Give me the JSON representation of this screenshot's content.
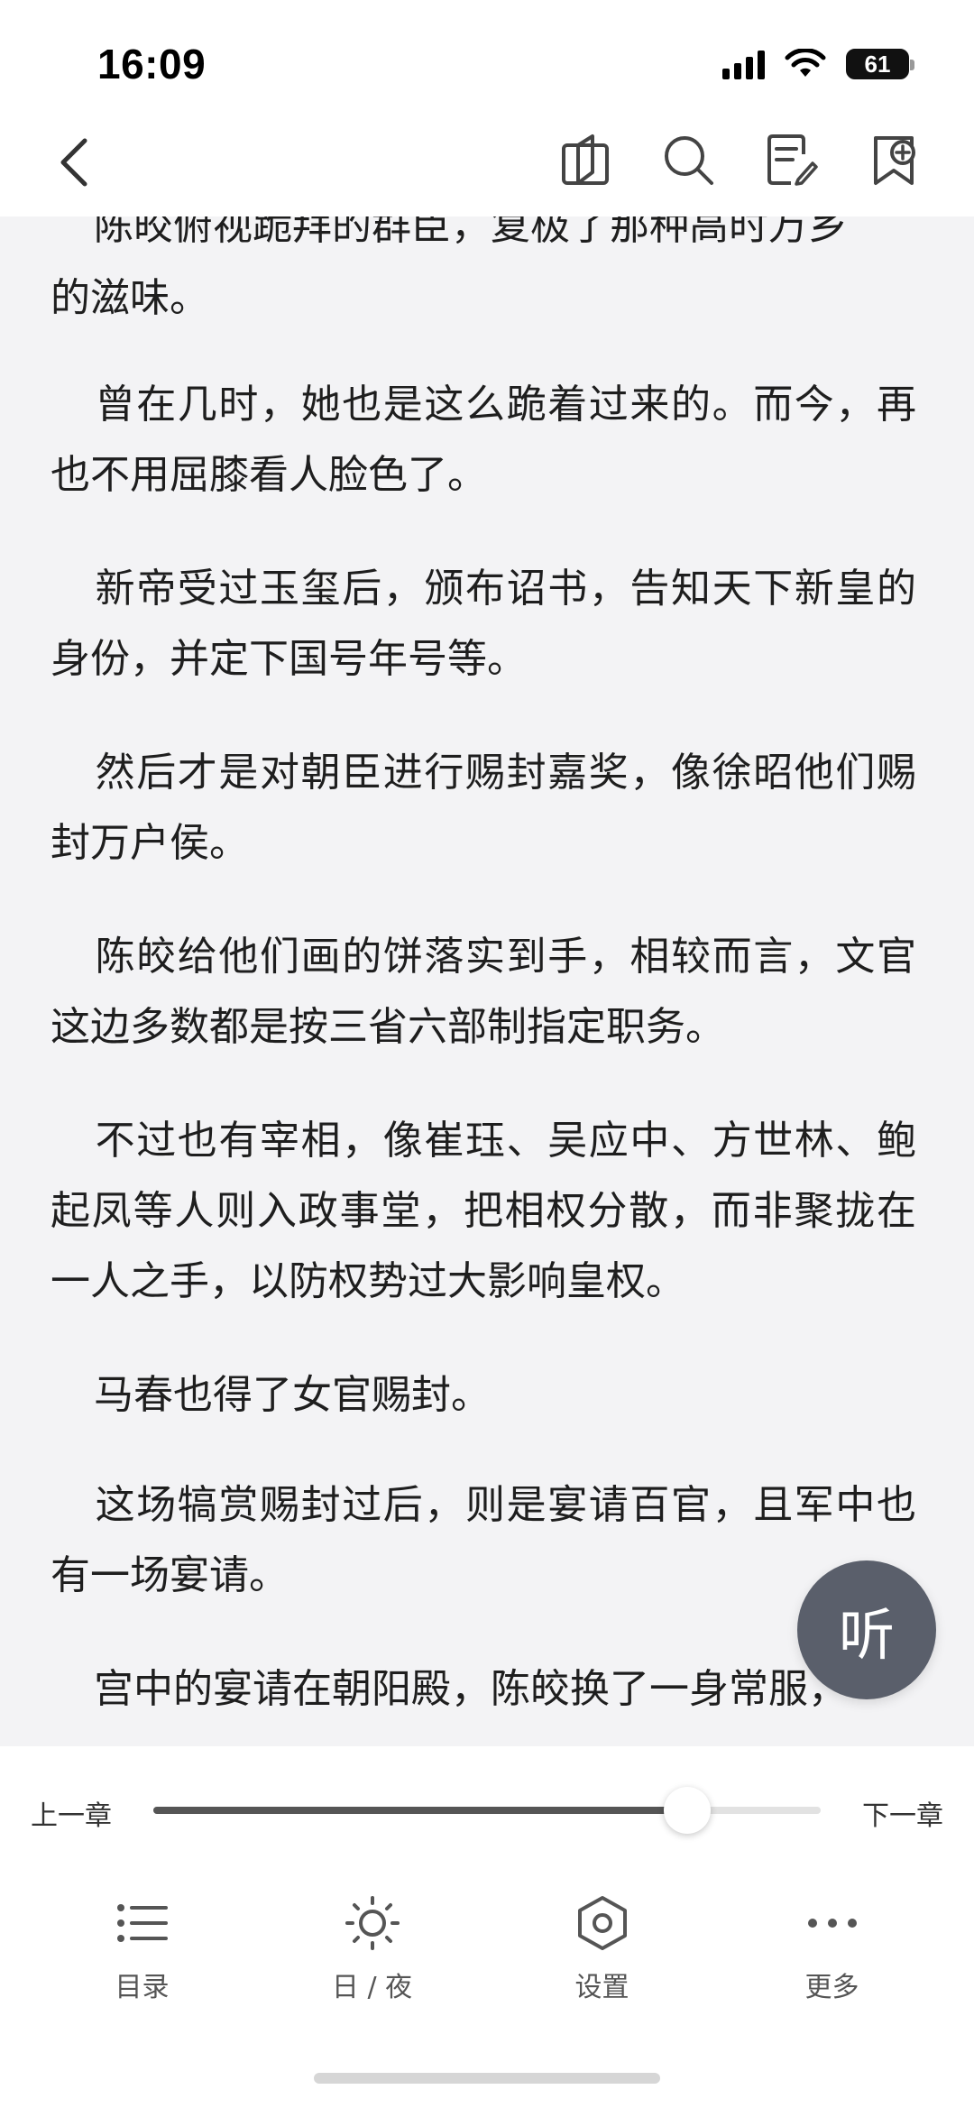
{
  "status_bar": {
    "time": "16:09",
    "battery": "61",
    "icons": [
      "signal-icon",
      "wifi-icon",
      "battery-icon"
    ]
  },
  "header": {
    "back_icon": "chevron-left-icon",
    "actions": [
      {
        "name": "book-details-icon"
      },
      {
        "name": "search-icon"
      },
      {
        "name": "notes-icon"
      },
      {
        "name": "bookmark-add-icon"
      }
    ]
  },
  "reader": {
    "paragraphs": [
      "陈皎俯视跪拜的群臣，复极了那种高时万乡",
      "的滋味。",
      "曾在几时，她也是这么跪着过来的。而今，再也不用屈膝看人脸色了。",
      "新帝受过玉玺后，颁布诏书，告知天下新皇的身份，并定下国号年号等。",
      "然后才是对朝臣进行赐封嘉奖，像徐昭他们赐封万户侯。",
      "陈皎给他们画的饼落实到手，相较而言，文官这边多数都是按三省六部制指定职务。",
      "不过也有宰相，像崔珏、吴应中、方世林、鲍起凤等人则入政事堂，把相权分散，而非聚拢在一人之手，以防权势过大影响皇权。",
      "马春也得了女官赐封。",
      "这场犒赏赐封过后，则是宴请百官，且军中也有一场宴请。",
      "宫中的宴请在朝阳殿，陈皎换了一身常服，"
    ]
  },
  "listen_button": {
    "label": "听"
  },
  "chapter_nav": {
    "prev": "上一章",
    "next": "下一章",
    "progress": 0.8
  },
  "toolbar": {
    "items": [
      {
        "label": "目录",
        "icon": "list-icon"
      },
      {
        "label": "日 / 夜",
        "icon": "sun-icon"
      },
      {
        "label": "设置",
        "icon": "settings-icon"
      },
      {
        "label": "更多",
        "icon": "more-icon"
      }
    ]
  }
}
